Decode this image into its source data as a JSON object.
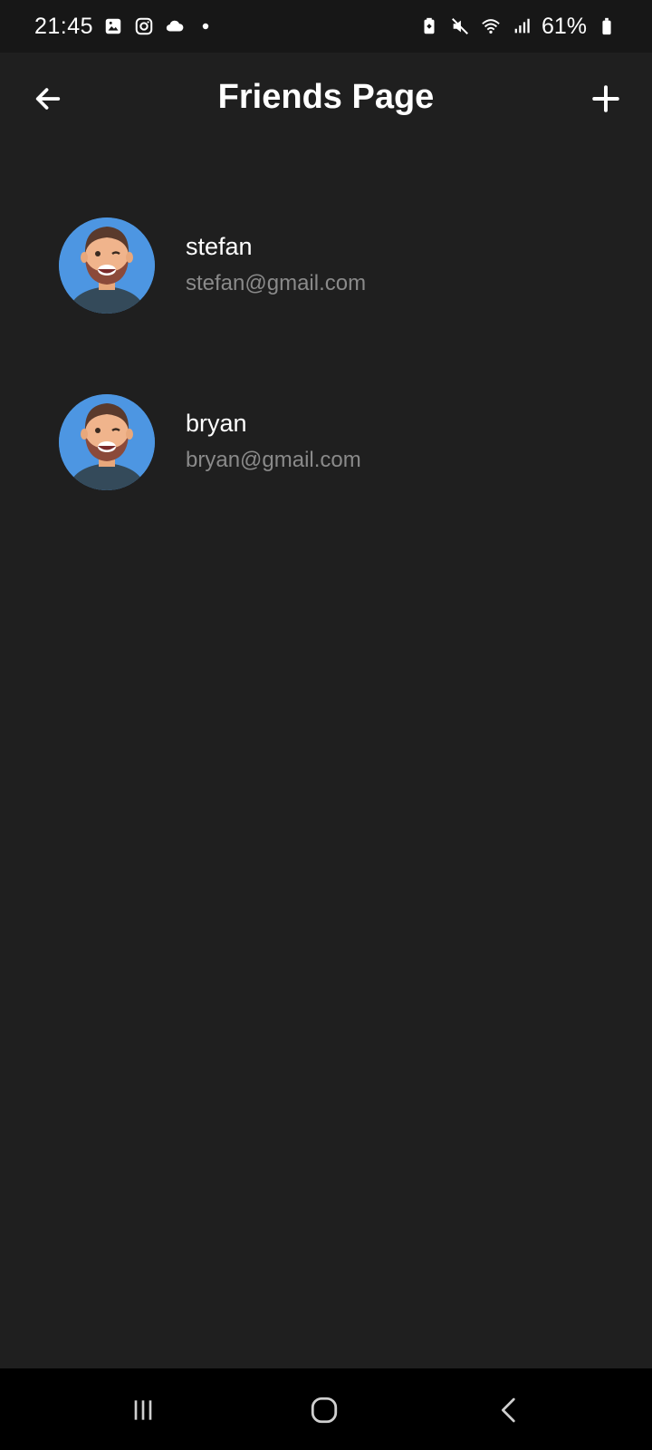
{
  "status_bar": {
    "time": "21:45",
    "battery_percent": "61%",
    "left_icons": [
      "gallery-icon",
      "instagram-icon",
      "cloud-icon",
      "dot-icon"
    ],
    "right_icons": [
      "battery-saver-icon",
      "mute-icon",
      "wifi-icon",
      "signal-icon",
      "battery-icon"
    ]
  },
  "app_bar": {
    "title": "Friends Page",
    "back_icon": "arrow-left-icon",
    "add_icon": "plus-icon"
  },
  "friends": [
    {
      "name": "stefan",
      "email": "stefan@gmail.com",
      "avatar": "avatar-icon"
    },
    {
      "name": "bryan",
      "email": "bryan@gmail.com",
      "avatar": "avatar-icon"
    }
  ],
  "nav_bar": {
    "recents_icon": "recents-icon",
    "home_icon": "home-icon",
    "back_icon": "back-chevron-icon"
  },
  "colors": {
    "background": "#1f1f1f",
    "status_bar": "#171717",
    "nav_bar": "#000000",
    "text_primary": "#ffffff",
    "text_secondary": "#8a8a8a",
    "avatar_bg": "#4d96e2"
  }
}
